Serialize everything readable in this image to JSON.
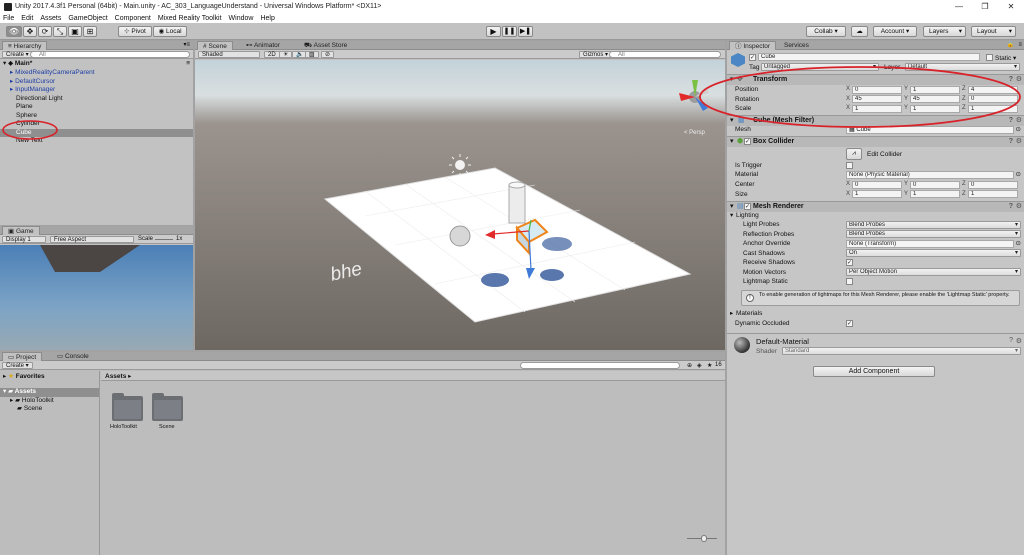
{
  "window": {
    "title": "Unity 2017.4.3f1 Personal (64bit) - Main.unity - AC_303_LanguageUnderstand - Universal Windows Platform* <DX11>",
    "minimize_glyph": "—",
    "restore_glyph": "❐",
    "close_glyph": "✕"
  },
  "menu": [
    "File",
    "Edit",
    "Assets",
    "GameObject",
    "Component",
    "Mixed Reality Toolkit",
    "Window",
    "Help"
  ],
  "toolbar": {
    "pivot": "Pivot",
    "local": "Local",
    "collab": "Collab ▾",
    "account": "Account ▾",
    "layers": "Layers",
    "layout": "Layout"
  },
  "hierarchy": {
    "tab": "Hierarchy",
    "create": "Create ▾",
    "search_placeholder": "All",
    "scene_name": "Main*",
    "items": [
      {
        "label": "MixedRealityCameraParent",
        "blue": true,
        "arrow": true
      },
      {
        "label": "DefaultCursor",
        "blue": true,
        "arrow": true
      },
      {
        "label": "InputManager",
        "blue": true,
        "arrow": true
      },
      {
        "label": "Directional Light",
        "blue": false,
        "arrow": false
      },
      {
        "label": "Plane",
        "blue": false,
        "arrow": false
      },
      {
        "label": "Sphere",
        "blue": false,
        "arrow": false
      },
      {
        "label": "Cylinder",
        "blue": false,
        "arrow": false
      },
      {
        "label": "Cube",
        "blue": false,
        "arrow": false,
        "selected": true
      },
      {
        "label": "New Text",
        "blue": false,
        "arrow": false
      }
    ]
  },
  "game": {
    "tab": "Game",
    "display": "Display 1",
    "aspect": "Free Aspect",
    "scale_label": "Scale",
    "scale_value": "1x"
  },
  "scene": {
    "tabs": [
      "Scene",
      "Animator",
      "Asset Store"
    ],
    "shaded": "Shaded",
    "mode_2d": "2D",
    "gizmos": "Gizmos ▾",
    "search_placeholder": "All",
    "persp": "< Persp",
    "watermark": "bhe"
  },
  "inspector": {
    "tabs": [
      "Inspector",
      "Services"
    ],
    "object_name": "Cube",
    "static_label": "Static ▾",
    "tag_label": "Tag",
    "tag_value": "Untagged",
    "layer_label": "Layer",
    "layer_value": "Default",
    "transform": {
      "title": "Transform",
      "position_label": "Position",
      "rotation_label": "Rotation",
      "scale_label": "Scale",
      "position": [
        "0",
        "1",
        "4"
      ],
      "rotation": [
        "45",
        "45",
        "0"
      ],
      "scale": [
        "1",
        "1",
        "1"
      ]
    },
    "mesh_filter": {
      "title": "Cube (Mesh Filter)",
      "mesh_label": "Mesh",
      "mesh_value": "Cube"
    },
    "box_collider": {
      "title": "Box Collider",
      "edit_collider": "Edit Collider",
      "is_trigger": "Is Trigger",
      "material_label": "Material",
      "material_value": "None (Physic Material)",
      "center_label": "Center",
      "center": [
        "0",
        "0",
        "0"
      ],
      "size_label": "Size",
      "size": [
        "1",
        "1",
        "1"
      ]
    },
    "mesh_renderer": {
      "title": "Mesh Renderer",
      "lighting": "Lighting",
      "light_probes_label": "Light Probes",
      "light_probes": "Blend Probes",
      "reflection_probes_label": "Reflection Probes",
      "reflection_probes": "Blend Probes",
      "anchor_override_label": "Anchor Override",
      "anchor_override": "None (Transform)",
      "cast_shadows_label": "Cast Shadows",
      "cast_shadows": "On",
      "receive_shadows_label": "Receive Shadows",
      "motion_vectors_label": "Motion Vectors",
      "motion_vectors": "Per Object Motion",
      "lightmap_static_label": "Lightmap Static",
      "info": "To enable generation of lightmaps for this Mesh Renderer, please enable the 'Lightmap Static' property.",
      "materials": "Materials",
      "dynamic_occluded": "Dynamic Occluded"
    },
    "material": {
      "name": "Default-Material",
      "shader_label": "Shader",
      "shader_value": "Standard"
    },
    "add_component": "Add Component"
  },
  "project": {
    "tabs": [
      "Project",
      "Console"
    ],
    "create": "Create ▾",
    "favorites": "Favorites",
    "assets": "Assets",
    "tree": [
      "HoloToolkit",
      "Scene"
    ],
    "breadcrumb": "Assets ▸",
    "folders": [
      "HoloToolkit",
      "Scene"
    ],
    "tree_counts": "16"
  },
  "colors": {
    "annotation_red": "#d8232a",
    "selection_gray": "#8f8f8f",
    "prefab_blue": "#1e3ea5",
    "scene_bg": "#6e6862",
    "sky_top": "#c3d2d9"
  }
}
